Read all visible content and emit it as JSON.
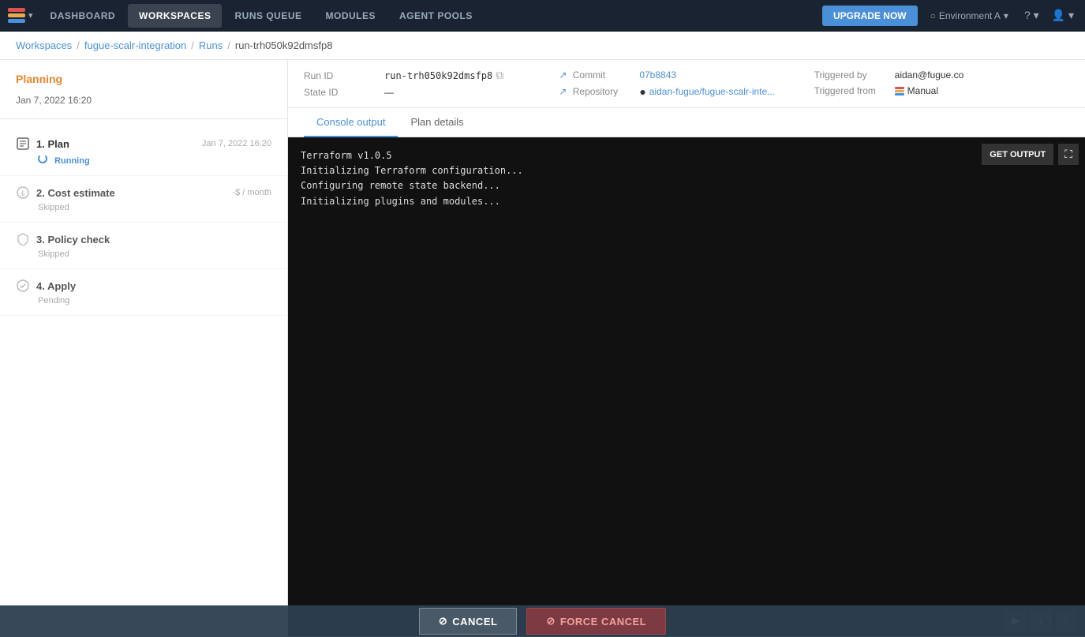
{
  "nav": {
    "items": [
      {
        "id": "dashboard",
        "label": "DASHBOARD",
        "active": false
      },
      {
        "id": "workspaces",
        "label": "WORKSPACES",
        "active": true
      },
      {
        "id": "runs-queue",
        "label": "RUNS QUEUE",
        "active": false
      },
      {
        "id": "modules",
        "label": "MODULES",
        "active": false
      },
      {
        "id": "agent-pools",
        "label": "AGENT POOLS",
        "active": false
      }
    ],
    "upgrade_label": "UPGRADE NOW",
    "env_label": "Environment A",
    "chevron": "▾"
  },
  "breadcrumb": {
    "items": [
      {
        "label": "Workspaces",
        "href": "#"
      },
      {
        "label": "fugue-scalr-integration",
        "href": "#"
      },
      {
        "label": "Runs",
        "href": "#"
      },
      {
        "label": "run-trh050k92dmsfp8",
        "href": null
      }
    ]
  },
  "run": {
    "status": "Planning",
    "date": "Jan 7, 2022 16:20",
    "run_id_label": "Run ID",
    "run_id": "run-trh050k92dmsfp8",
    "state_id_label": "State ID",
    "state_id": "—",
    "commit_label": "Commit",
    "commit_hash": "07b8843",
    "repository_label": "Repository",
    "repository": "aidan-fugue/fugue-scalr-inte...",
    "triggered_by_label": "Triggered by",
    "triggered_by": "aidan@fugue.co",
    "triggered_from_label": "Triggered from",
    "triggered_from": "Manual"
  },
  "steps": [
    {
      "id": 1,
      "icon": "plan-icon",
      "label": "1. Plan",
      "status": "Running",
      "status_type": "running",
      "date": "Jan 7, 2022 16:20",
      "extra": null
    },
    {
      "id": 2,
      "icon": "cost-icon",
      "label": "2. Cost estimate",
      "status": "Skipped",
      "status_type": "skipped",
      "date": null,
      "extra": "-$ / month"
    },
    {
      "id": 3,
      "icon": "policy-icon",
      "label": "3. Policy check",
      "status": "Skipped",
      "status_type": "skipped",
      "date": null,
      "extra": null
    },
    {
      "id": 4,
      "icon": "apply-icon",
      "label": "4. Apply",
      "status": "Pending",
      "status_type": "pending",
      "date": null,
      "extra": null
    }
  ],
  "tabs": [
    {
      "id": "console",
      "label": "Console output",
      "active": true
    },
    {
      "id": "plan-details",
      "label": "Plan details",
      "active": false
    }
  ],
  "console": {
    "lines": [
      "Terraform v1.0.5",
      "Initializing Terraform configuration...",
      "Configuring remote state backend...",
      "Initializing plugins and modules..."
    ],
    "get_output_label": "GET OUTPUT",
    "fullscreen_char": "⛶"
  },
  "scroll_controls": {
    "play": "▶",
    "down": "↓",
    "up": "↑"
  },
  "bottom_bar": {
    "cancel_label": "CANCEL",
    "force_cancel_label": "FORCE CANCEL",
    "cancel_icon": "⊘",
    "force_cancel_icon": "⊘"
  }
}
